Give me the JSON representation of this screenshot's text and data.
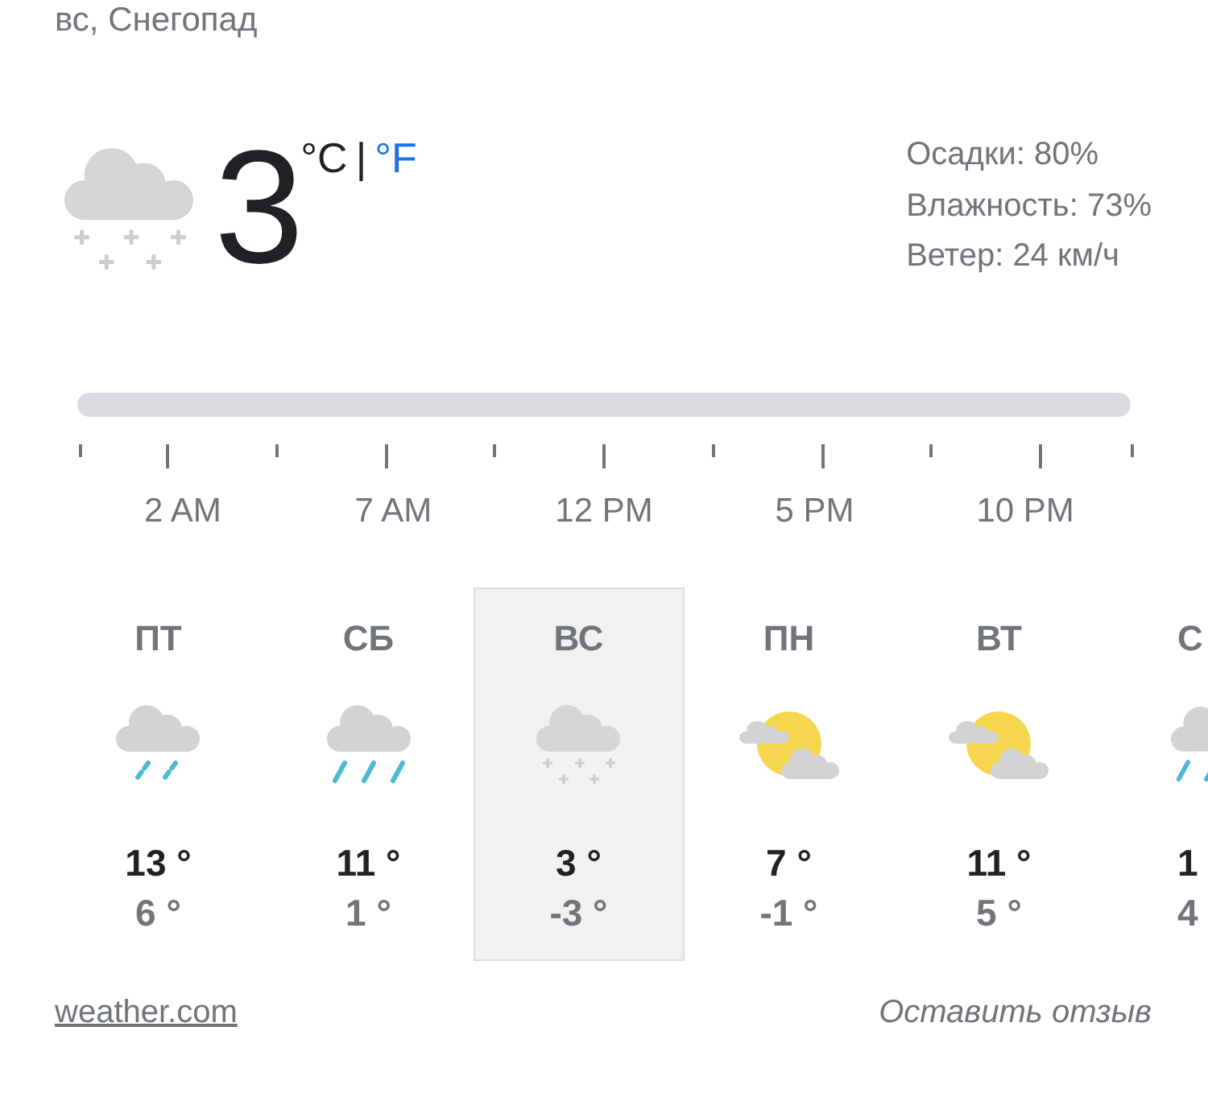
{
  "header": {
    "title": "вс, Снегопад"
  },
  "current": {
    "kind": "snow",
    "temperature": "3",
    "units": [
      {
        "label": "°C",
        "selected": true
      },
      {
        "label": "°F",
        "selected": false
      }
    ],
    "unit_separator": "|",
    "details": [
      "Осадки: 80%",
      "Влажность: 73%",
      "Ветер: 24 км/ч"
    ]
  },
  "timeline": {
    "labels": [
      "2 AM",
      "7 AM",
      "12 PM",
      "5 PM",
      "10 PM"
    ]
  },
  "days": [
    {
      "day": "ПТ",
      "kind": "light_rain",
      "high": "13 °",
      "low": "6 °",
      "selected": false,
      "cut_off": false
    },
    {
      "day": "СБ",
      "kind": "rain",
      "high": "11 °",
      "low": "1 °",
      "selected": false,
      "cut_off": false
    },
    {
      "day": "ВС",
      "kind": "snow",
      "high": "3 °",
      "low": "-3 °",
      "selected": true,
      "cut_off": false
    },
    {
      "day": "ПН",
      "kind": "partly_cloudy",
      "high": "7 °",
      "low": "-1 °",
      "selected": false,
      "cut_off": false
    },
    {
      "day": "ВТ",
      "kind": "partly_cloudy",
      "high": "11 °",
      "low": "5 °",
      "selected": false,
      "cut_off": false
    },
    {
      "day": "С",
      "kind": "rain",
      "high": "1",
      "low": "4",
      "selected": false,
      "cut_off": true
    }
  ],
  "footer": {
    "source_link": "weather.com",
    "feedback_link": "Оставить отзыв"
  }
}
